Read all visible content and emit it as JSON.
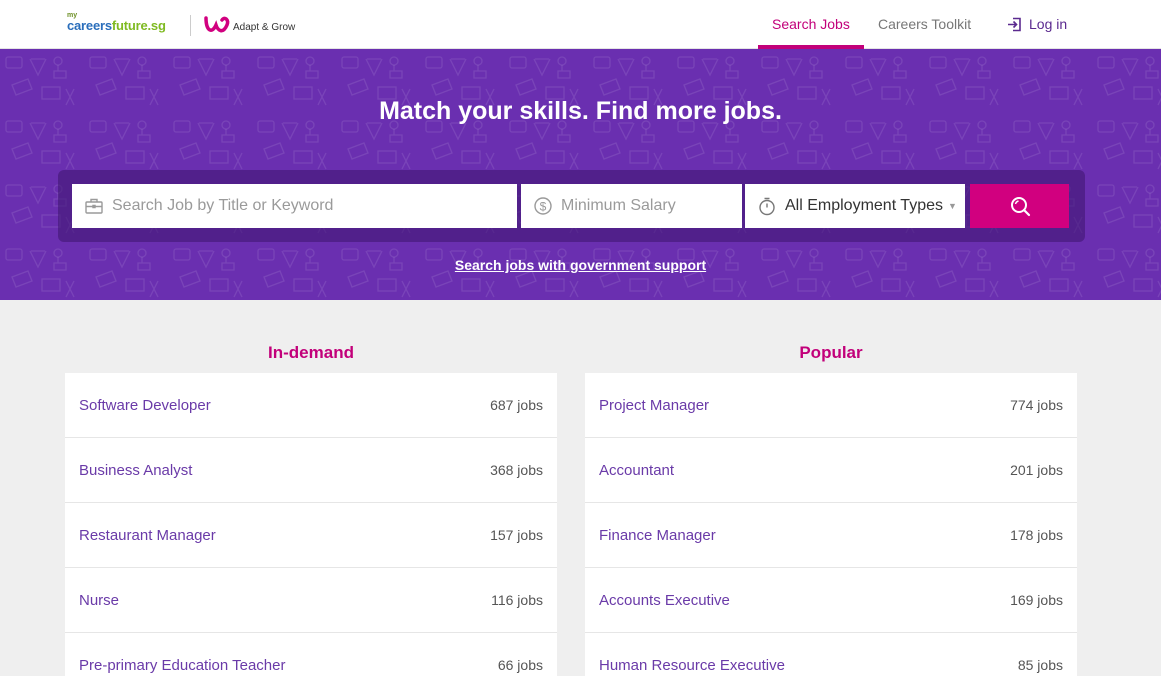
{
  "header": {
    "logo_prefix": "my",
    "logo_part1": "careers",
    "logo_part2": "future.sg",
    "partner_label": "Adapt & Grow",
    "nav": {
      "search_jobs": "Search Jobs",
      "careers_toolkit": "Careers Toolkit",
      "log_in": "Log in"
    }
  },
  "hero": {
    "title": "Match your skills. Find more jobs.",
    "search": {
      "keyword_placeholder": "Search Job by Title or Keyword",
      "salary_placeholder": "Minimum Salary",
      "employment_type": "All Employment Types"
    },
    "gov_link": "Search jobs with government support"
  },
  "in_demand": {
    "title": "In-demand",
    "items": [
      {
        "label": "Software Developer",
        "count": "687 jobs"
      },
      {
        "label": "Business Analyst",
        "count": "368 jobs"
      },
      {
        "label": "Restaurant Manager",
        "count": "157 jobs"
      },
      {
        "label": "Nurse",
        "count": "116 jobs"
      },
      {
        "label": "Pre-primary Education Teacher",
        "count": "66 jobs"
      }
    ]
  },
  "popular": {
    "title": "Popular",
    "items": [
      {
        "label": "Project Manager",
        "count": "774 jobs"
      },
      {
        "label": "Accountant",
        "count": "201 jobs"
      },
      {
        "label": "Finance Manager",
        "count": "178 jobs"
      },
      {
        "label": "Accounts Executive",
        "count": "169 jobs"
      },
      {
        "label": "Human Resource Executive",
        "count": "85 jobs"
      }
    ]
  },
  "colors": {
    "accent": "#c2007a",
    "hero_bg": "#6a2fb0",
    "link_purple": "#6a3aa8"
  },
  "icons": [
    "briefcase-icon",
    "dollar-icon",
    "timer-icon",
    "search-icon",
    "login-icon",
    "adapt-grow-logo-icon"
  ]
}
